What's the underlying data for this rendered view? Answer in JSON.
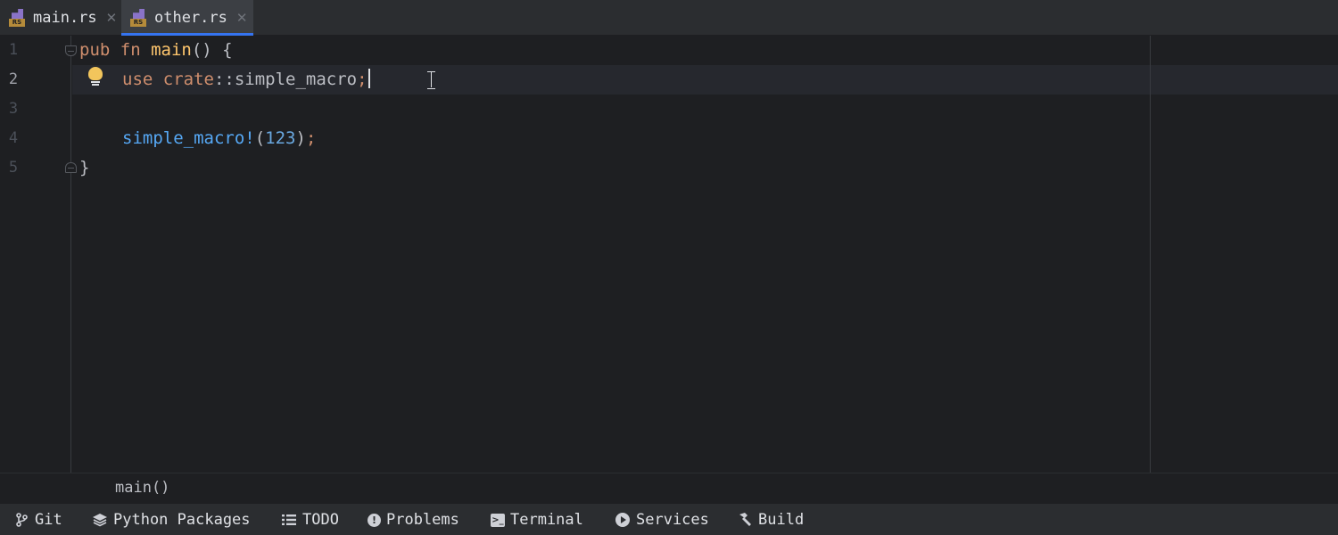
{
  "tabs": [
    {
      "label": "main.rs",
      "icon": "rust-file-icon",
      "icon_text": "RS",
      "active": false
    },
    {
      "label": "other.rs",
      "icon": "rust-file-icon",
      "icon_text": "RS",
      "active": true
    }
  ],
  "editor": {
    "line_numbers": [
      "1",
      "2",
      "3",
      "4",
      "5"
    ],
    "active_line": "2",
    "code": {
      "l1_kw": "pub fn ",
      "l1_name": "main",
      "l1_rest": "() {",
      "l2_kw1": "use ",
      "l2_kw2": "crate",
      "l2_ident": "::simple_macro",
      "l2_semi": ";",
      "l4_macro": "simple_macro!",
      "l4_open": "(",
      "l4_num": "123",
      "l4_close": ")",
      "l4_semi": ";",
      "l5": "}"
    }
  },
  "breadcrumb": {
    "text": "main()"
  },
  "tool_windows": [
    {
      "label": "Git",
      "icon": "git-branch-icon"
    },
    {
      "label": "Python Packages",
      "icon": "layers-icon"
    },
    {
      "label": "TODO",
      "icon": "list-icon"
    },
    {
      "label": "Problems",
      "icon": "alert-circle-icon"
    },
    {
      "label": "Terminal",
      "icon": "terminal-icon"
    },
    {
      "label": "Services",
      "icon": "play-circle-icon"
    },
    {
      "label": "Build",
      "icon": "hammer-icon"
    }
  ],
  "colors": {
    "accent": "#3574f0",
    "keyword": "#cf8e6d",
    "function": "#56a8f5",
    "number": "#6aa8e0",
    "bulb": "#f2c55c"
  }
}
